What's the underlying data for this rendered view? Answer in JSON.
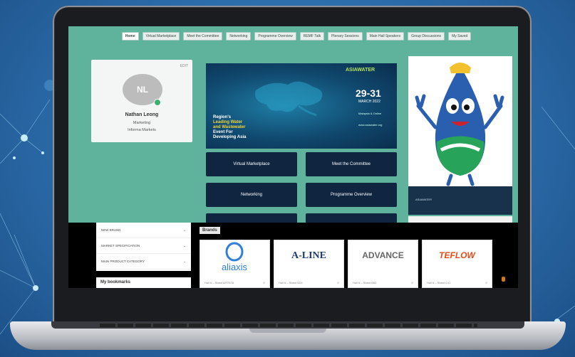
{
  "nav": {
    "items": [
      "Home",
      "Virtual Marketplace",
      "Meet the Committee",
      "Networking",
      "Programme Overview",
      "REMF Talk",
      "Plenary Sessions",
      "Main Hall Speakers",
      "Group Discussions",
      "My Saved"
    ]
  },
  "profile": {
    "edit_label": "EDIT",
    "initials": "NL",
    "name": "Nathan Leong",
    "role": "Marketing",
    "company": "Informa Markets"
  },
  "banner": {
    "logo": "ASIAWATER",
    "headline_1": "Region's",
    "headline_2": "Leading Water",
    "headline_3": "and Wastewater",
    "headline_4": "Event For",
    "headline_5": "Developing Asia",
    "dates": "29-31",
    "month": "MARCH 2022",
    "venue": "Malaysia & Online",
    "site": "www.asiawater.org"
  },
  "tiles": [
    "Virtual Marketplace",
    "Meet the Committee",
    "Networking",
    "Programme Overview"
  ],
  "sponsor": {
    "text": "ASIAWATER"
  },
  "filters": {
    "rows": [
      "NEW BRAND",
      "MARKET SPECIFICATION",
      "MAIN PRODUCT CATEGORY"
    ]
  },
  "bookmarks_title": "My bookmarks",
  "brands": {
    "label": "Brands",
    "cards": [
      {
        "name": "aliaxis",
        "stand": "Hall 6 – Stand 6FI7878",
        "color": "#2f7ed8"
      },
      {
        "name": "A-LINE",
        "stand": "Hall 6 – Stand 6D4",
        "color": "#1f3a6d"
      },
      {
        "name": "ADVANCE",
        "stand": "Hall 6 – Stand 6B3",
        "color": "#666666"
      },
      {
        "name": "TEFLOW",
        "stand": "Hall 6 – Stand C41",
        "color": "#e84a1b"
      }
    ]
  },
  "colors": {
    "site_bg": "#5fb29c",
    "tile_bg": "#0f2540"
  }
}
